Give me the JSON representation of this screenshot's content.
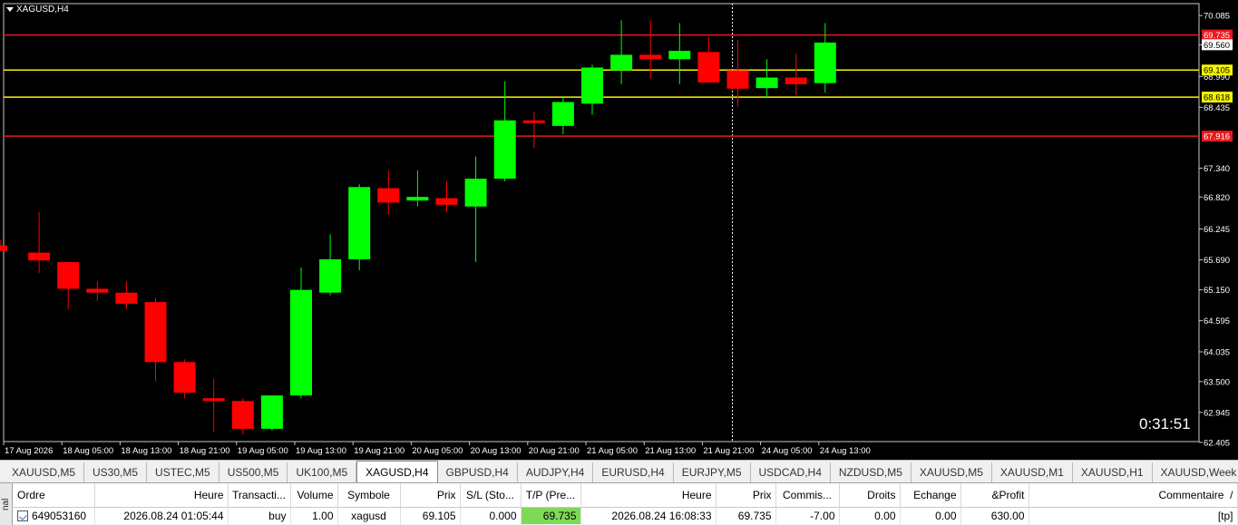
{
  "chart": {
    "symbol_title": "XAGUSD,H4",
    "timer": "0:31:51",
    "colors": {
      "bull": "#00ff00",
      "bear": "#ff0000",
      "bg": "#000000",
      "hline_red": "#e8191e",
      "hline_yellow": "#f5f500"
    }
  },
  "chart_data": {
    "type": "candlestick",
    "title": "XAGUSD,H4",
    "ylim": [
      62.42,
      70.3
    ],
    "y_ticks": [
      "70.085",
      "69.560",
      "68.990",
      "68.435",
      "67.340",
      "66.820",
      "66.245",
      "65.690",
      "65.150",
      "64.595",
      "64.035",
      "63.500",
      "62.945",
      "62.405"
    ],
    "x_labels": [
      "17 Aug 2026",
      "18 Aug 05:00",
      "18 Aug 13:00",
      "18 Aug 21:00",
      "19 Aug 05:00",
      "19 Aug 13:00",
      "19 Aug 21:00",
      "20 Aug 05:00",
      "20 Aug 13:00",
      "20 Aug 21:00",
      "21 Aug 05:00",
      "21 Aug 13:00",
      "21 Aug 21:00",
      "24 Aug 05:00",
      "24 Aug 13:00"
    ],
    "candles": [
      {
        "o": 65.95,
        "h": 66.05,
        "l": 65.85,
        "c": 65.85
      },
      {
        "o": 65.82,
        "h": 66.55,
        "l": 65.45,
        "c": 65.68
      },
      {
        "o": 65.65,
        "h": 65.65,
        "l": 64.8,
        "c": 65.17
      },
      {
        "o": 65.17,
        "h": 65.3,
        "l": 64.95,
        "c": 65.1
      },
      {
        "o": 65.1,
        "h": 65.3,
        "l": 64.8,
        "c": 64.9
      },
      {
        "o": 64.93,
        "h": 65.0,
        "l": 63.5,
        "c": 63.85
      },
      {
        "o": 63.85,
        "h": 63.9,
        "l": 63.2,
        "c": 63.3
      },
      {
        "o": 63.2,
        "h": 63.55,
        "l": 62.6,
        "c": 63.15
      },
      {
        "o": 63.15,
        "h": 63.2,
        "l": 62.55,
        "c": 62.65
      },
      {
        "o": 62.65,
        "h": 63.25,
        "l": 62.62,
        "c": 63.25
      },
      {
        "o": 63.25,
        "h": 65.55,
        "l": 63.2,
        "c": 65.15
      },
      {
        "o": 65.1,
        "h": 66.15,
        "l": 65.05,
        "c": 65.7
      },
      {
        "o": 65.7,
        "h": 67.05,
        "l": 65.5,
        "c": 67.0
      },
      {
        "o": 66.98,
        "h": 67.3,
        "l": 66.5,
        "c": 66.72
      },
      {
        "o": 66.78,
        "h": 67.3,
        "l": 66.65,
        "c": 66.8
      },
      {
        "o": 66.8,
        "h": 67.1,
        "l": 66.55,
        "c": 66.68
      },
      {
        "o": 66.65,
        "h": 67.55,
        "l": 65.65,
        "c": 67.15
      },
      {
        "o": 67.15,
        "h": 68.9,
        "l": 67.1,
        "c": 68.2
      },
      {
        "o": 68.2,
        "h": 68.35,
        "l": 67.7,
        "c": 68.15
      },
      {
        "o": 68.1,
        "h": 68.6,
        "l": 67.95,
        "c": 68.53
      },
      {
        "o": 68.5,
        "h": 69.2,
        "l": 68.3,
        "c": 69.15
      },
      {
        "o": 69.1,
        "h": 70.0,
        "l": 68.85,
        "c": 69.38
      },
      {
        "o": 69.38,
        "h": 70.0,
        "l": 68.95,
        "c": 69.3
      },
      {
        "o": 69.3,
        "h": 69.95,
        "l": 68.85,
        "c": 69.45
      },
      {
        "o": 69.43,
        "h": 69.7,
        "l": 68.9,
        "c": 68.88
      },
      {
        "o": 69.1,
        "h": 69.65,
        "l": 68.45,
        "c": 68.77
      },
      {
        "o": 68.78,
        "h": 69.3,
        "l": 68.6,
        "c": 68.97
      },
      {
        "o": 68.97,
        "h": 69.4,
        "l": 68.65,
        "c": 68.85
      },
      {
        "o": 68.87,
        "h": 69.95,
        "l": 68.7,
        "c": 69.6
      }
    ],
    "hlines": [
      {
        "price": 69.735,
        "label": "69.735",
        "color": "#e8191e"
      },
      {
        "price": 69.105,
        "label": "69.105",
        "color": "#f5f500"
      },
      {
        "price": 68.618,
        "label": "68.618",
        "color": "#f5f500"
      },
      {
        "price": 67.916,
        "label": "67.916",
        "color": "#e8191e"
      }
    ],
    "current_price": "69.560",
    "grid": false
  },
  "tabs": [
    {
      "label": "XAUUSD,M5",
      "active": false
    },
    {
      "label": "US30,M5",
      "active": false
    },
    {
      "label": "USTEC,M5",
      "active": false
    },
    {
      "label": "US500,M5",
      "active": false
    },
    {
      "label": "UK100,M5",
      "active": false
    },
    {
      "label": "XAGUSD,H4",
      "active": true
    },
    {
      "label": "GBPUSD,H4",
      "active": false
    },
    {
      "label": "AUDJPY,H4",
      "active": false
    },
    {
      "label": "EURUSD,H4",
      "active": false
    },
    {
      "label": "EURJPY,M5",
      "active": false
    },
    {
      "label": "USDCAD,H4",
      "active": false
    },
    {
      "label": "NZDUSD,M5",
      "active": false
    },
    {
      "label": "XAUUSD,M5",
      "active": false
    },
    {
      "label": "XAUUSD,M1",
      "active": false
    },
    {
      "label": "XAUUSD,H1",
      "active": false
    },
    {
      "label": "XAUUSD,Week",
      "active": false
    }
  ],
  "terminal": {
    "side_label": "nal",
    "headers": [
      "Ordre",
      "Heure",
      "Transacti...",
      "Volume",
      "Symbole",
      "Prix",
      "S/L (Sto...",
      "T/P (Pre...",
      "Heure",
      "Prix",
      "Commis...",
      "Droits",
      "Echange",
      "&Profit",
      "Commentaire"
    ],
    "sort_indicator": "/",
    "row": {
      "ordre": "649053160",
      "heure_open": "2026.08.24 01:05:44",
      "transaction": "buy",
      "volume": "1.00",
      "symbole": "xagusd",
      "prix_open": "69.105",
      "sl": "0.000",
      "tp": "69.735",
      "heure_close": "2026.08.24 16:08:33",
      "prix_close": "69.735",
      "commission": "-7.00",
      "droits": "0.00",
      "echange": "0.00",
      "profit": "630.00",
      "commentaire": "[tp]"
    }
  }
}
